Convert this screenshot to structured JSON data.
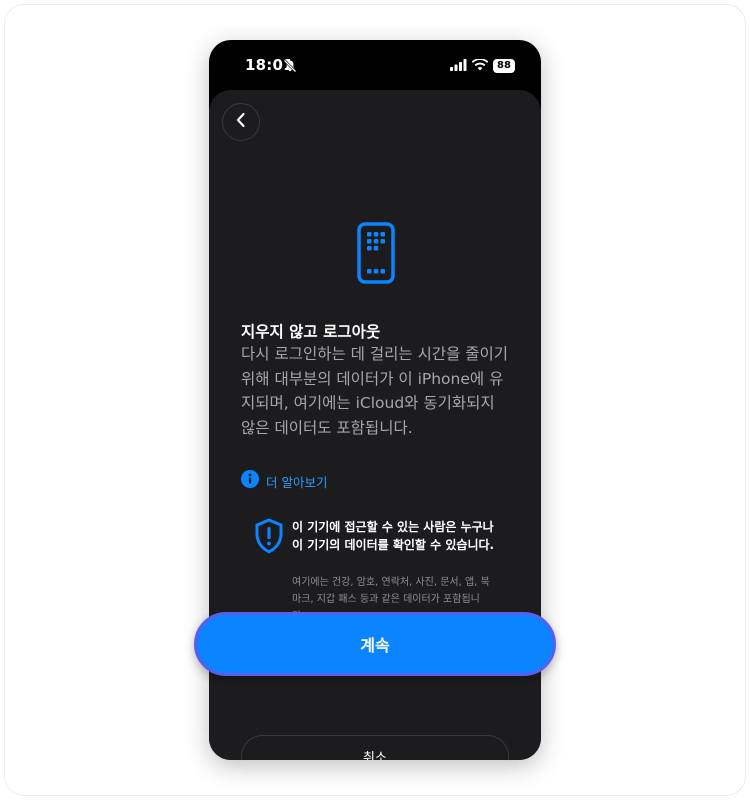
{
  "status_bar": {
    "time": "18:01",
    "battery": "88"
  },
  "header": {
    "back_icon": "chevron-left-icon"
  },
  "hero": {
    "icon": "phone-grid-icon",
    "accent_color": "#0a84ff"
  },
  "content": {
    "title": "지우지 않고 로그아웃",
    "description": "다시 로그인하는 데 걸리는 시간을 줄이기 위해 대부분의 데이터가 이 iPhone에 유지되며, 여기에는 iCloud와 동기화되지 않은 데이터도 포함됩니다.",
    "learn_more": "더 알아보기"
  },
  "warning": {
    "icon": "shield-exclamation-icon",
    "title": "이 기기에 접근할 수 있는 사람은 누구나 이 기기의 데이터를 확인할 수 있습니다.",
    "description": "여기에는 건강, 암호, 연락처, 사진, 문서, 앱, 북마크, 지갑 패스 등과 같은 데이터가 포함됩니다."
  },
  "actions": {
    "continue_label": "계속",
    "cancel_label": "취소"
  },
  "colors": {
    "background": "#000000",
    "sheet": "#1c1c1e",
    "primary": "#0a84ff",
    "link": "#2d9bff",
    "secondary_text": "#a6a6ab"
  }
}
